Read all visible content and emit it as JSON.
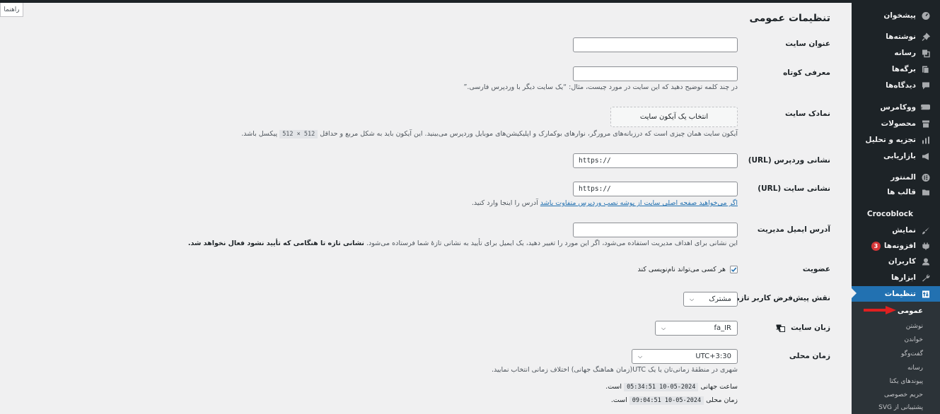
{
  "sidebar": {
    "items": [
      {
        "label": "پیشخوان",
        "icon": "dashboard-icon"
      },
      {
        "label": "نوشته‌ها",
        "icon": "pin-icon"
      },
      {
        "label": "رسانه",
        "icon": "media-icon"
      },
      {
        "label": "برگه‌ها",
        "icon": "page-icon"
      },
      {
        "label": "دیدگاه‌ها",
        "icon": "comment-icon"
      },
      {
        "label": "ووکامرس",
        "icon": "woo-icon"
      },
      {
        "label": "محصولات",
        "icon": "archive-icon"
      },
      {
        "label": "تجزیه و تحلیل",
        "icon": "chart-icon"
      },
      {
        "label": "بازاریابی",
        "icon": "megaphone-icon"
      },
      {
        "label": "المنتور",
        "icon": "elementor-icon"
      },
      {
        "label": "قالب ها",
        "icon": "folder-icon"
      },
      {
        "label": "Crocoblock",
        "icon": ""
      },
      {
        "label": "نمایش",
        "icon": "brush-icon"
      },
      {
        "label": "افزونه‌ها",
        "icon": "plugin-icon",
        "badge": "3"
      },
      {
        "label": "کاربران",
        "icon": "user-icon"
      },
      {
        "label": "ابزارها",
        "icon": "wrench-icon"
      },
      {
        "label": "تنظیمات",
        "icon": "settings-icon"
      }
    ],
    "submenu": [
      "عمومی",
      "نوشتن",
      "خواندن",
      "گفت‌وگو",
      "رسانه",
      "پیوندهای یکتا",
      "حریم خصوصی",
      "پشتیبانی از SVG"
    ]
  },
  "help_button": "راهنما",
  "page": {
    "title": "تنظیمات عمومی",
    "site_title": {
      "label": "عنوان سایت",
      "value": ""
    },
    "tagline": {
      "label": "معرفی کوتاه",
      "value": "",
      "desc": "در چند کلمه توضیح دهید که این سایت در مورد چیست، مثال: “یک سایت دیگر با وردپرس فارسی.”"
    },
    "site_icon": {
      "label": "نمادک سایت",
      "button": "انتخاب یک آیکون سایت",
      "desc_before": "آیکون سایت همان چیزی است که درزبانه‌های مرورگر، نوارهای بوکمارک و اپلیکیشن‌های موبایل وردپرس می‌بینید. این آیکون باید به شکل مربع و حداقل",
      "desc_code": "512 × 512",
      "desc_after": "پیکسل باشد."
    },
    "wp_url": {
      "label": "نشانی وردپرس (URL)",
      "value": "https://"
    },
    "site_url": {
      "label": "نشانی سایت (URL)",
      "value": "https://",
      "desc_link": "اگر می‌خواهید صفحه اصلی سایت از پوشه نصب وردپرس متفاوت باشد",
      "desc_after": "آدرس را اینجا وارد کنید."
    },
    "admin_email": {
      "label": "آدرس ایمیل مدیریت",
      "value": "",
      "desc": "این نشانی برای اهداف مدیریت استفاده می‌شود، اگر این مورد را تغییر دهید، یک ایمیل برای تأیید به نشانی تازهٔ شما فرستاده می‌شود.",
      "desc_bold": "نشانی تازه تا هنگامی که تأیید نشود فعال نخواهد شد."
    },
    "membership": {
      "label": "عضویت",
      "checkbox_label": "هر کسی می‌تواند نام‌نویسی کند",
      "checked": true
    },
    "default_role": {
      "label": "نقش پیش‌فرض کاربر تازه",
      "value": "مشترک"
    },
    "site_language": {
      "label": "زبان سایت",
      "value": "fa_IR"
    },
    "timezone": {
      "label": "زمان محلی",
      "value": "UTC+3:30",
      "desc": "شهری در منطقهٔ زمانی‌تان یا یک UTC(زمان هماهنگ جهانی) اختلاف زمانی انتخاب نمایید."
    },
    "utc_time": {
      "prefix": "ساعت جهانی",
      "value": "2024-05-10 05:34:51",
      "suffix": "است."
    },
    "local_time": {
      "prefix": "زمان محلی",
      "value": "2024-05-10 09:04:51",
      "suffix": "است."
    }
  },
  "colors": {
    "sidebar_bg": "#1d2327",
    "accent": "#2271b1",
    "badge": "#d63638",
    "arrow": "#e02020"
  }
}
